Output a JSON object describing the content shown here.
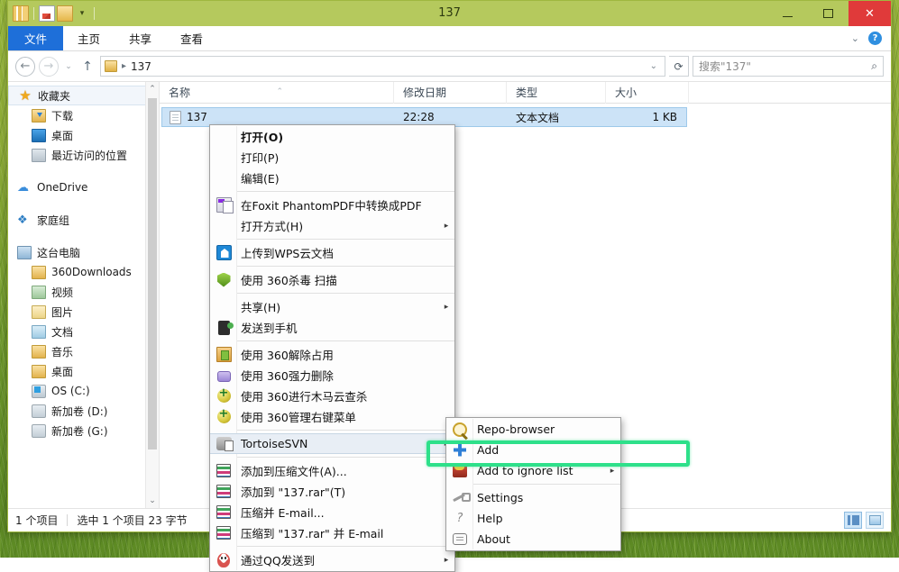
{
  "window": {
    "title": "137",
    "quick_access": [
      "folder-stripes-icon",
      "document-icon",
      "folder-icon",
      "dropdown-caret-icon"
    ],
    "controls": {
      "minimize": "—",
      "maximize": "□",
      "close": "✕"
    }
  },
  "ribbon": {
    "tabs": [
      {
        "id": "file",
        "label": "文件"
      },
      {
        "id": "home",
        "label": "主页"
      },
      {
        "id": "share",
        "label": "共享"
      },
      {
        "id": "view",
        "label": "查看"
      }
    ],
    "collapse_caret": "⌄",
    "help_label": "?"
  },
  "address_bar": {
    "back": "←",
    "forward": "→",
    "history_caret": "⌄",
    "up": "↑",
    "crumb_separator": "▸",
    "path": "137",
    "dropdown_caret": "⌄",
    "refresh": "⟳",
    "search_placeholder": "搜索\"137\"",
    "search_value": "",
    "search_icon": "⌕"
  },
  "nav_pane": {
    "items": [
      {
        "label": "收藏夹",
        "icon": "star-icon",
        "level": 1,
        "selected": true
      },
      {
        "label": "下载",
        "icon": "download-folder-icon",
        "level": 2
      },
      {
        "label": "桌面",
        "icon": "desktop-icon",
        "level": 2
      },
      {
        "label": "最近访问的位置",
        "icon": "recent-places-icon",
        "level": 2
      },
      {
        "label": "OneDrive",
        "icon": "onedrive-icon",
        "level": 1,
        "gap_before": true
      },
      {
        "label": "家庭组",
        "icon": "homegroup-icon",
        "level": 1,
        "gap_before": true
      },
      {
        "label": "这台电脑",
        "icon": "this-pc-icon",
        "level": 1,
        "gap_before": true
      },
      {
        "label": "360Downloads",
        "icon": "folder-icon",
        "level": 2
      },
      {
        "label": "视频",
        "icon": "videos-icon",
        "level": 2
      },
      {
        "label": "图片",
        "icon": "pictures-icon",
        "level": 2
      },
      {
        "label": "文档",
        "icon": "documents-icon",
        "level": 2
      },
      {
        "label": "音乐",
        "icon": "music-icon",
        "level": 2
      },
      {
        "label": "桌面",
        "icon": "desktop-folder-icon",
        "level": 2
      },
      {
        "label": "OS (C:)",
        "icon": "os-drive-icon",
        "level": 2
      },
      {
        "label": "新加卷 (D:)",
        "icon": "drive-icon",
        "level": 2
      },
      {
        "label": "新加卷 (G:)",
        "icon": "drive-icon",
        "level": 2
      }
    ],
    "scroll_up": "⌃",
    "scroll_down": "⌄"
  },
  "file_list": {
    "columns": [
      {
        "key": "name",
        "label": "名称",
        "sorted": true
      },
      {
        "key": "date",
        "label": "修改日期"
      },
      {
        "key": "type",
        "label": "类型"
      },
      {
        "key": "size",
        "label": "大小"
      }
    ],
    "sort_mark": "⌃",
    "rows": [
      {
        "name": "137",
        "icon": "text-file-icon",
        "date": "22:28",
        "type": "文本文档",
        "size": "1 KB",
        "selected": true
      }
    ]
  },
  "status_bar": {
    "item_count": "1 个项目",
    "selection": "选中 1 个项目 23 字节",
    "views": [
      {
        "name": "details-view",
        "active": true
      },
      {
        "name": "thumbnail-view",
        "active": false
      }
    ]
  },
  "context_menu": {
    "items": [
      {
        "label": "打开(O)",
        "bold": true,
        "icon": null
      },
      {
        "label": "打印(P)",
        "icon": null
      },
      {
        "label": "编辑(E)",
        "icon": null
      },
      {
        "separator": true
      },
      {
        "label": "在Foxit PhantomPDF中转换成PDF",
        "icon": "foxit-icon"
      },
      {
        "label": "打开方式(H)",
        "icon": null,
        "submenu": true
      },
      {
        "separator": true
      },
      {
        "label": "上传到WPS云文档",
        "icon": "wps-icon"
      },
      {
        "separator": true
      },
      {
        "label": "使用 360杀毒 扫描",
        "icon": "shield-360-icon"
      },
      {
        "separator": true
      },
      {
        "label": "共享(H)",
        "icon": null,
        "submenu": true
      },
      {
        "label": "发送到手机",
        "icon": "send-to-phone-icon"
      },
      {
        "separator": true
      },
      {
        "label": "使用 360解除占用",
        "icon": "360-unlock-icon"
      },
      {
        "label": "使用 360强力删除",
        "icon": "360-delete-icon"
      },
      {
        "label": "使用 360进行木马云查杀",
        "icon": "360-scan-icon"
      },
      {
        "label": "使用 360管理右键菜单",
        "icon": "360-manage-icon"
      },
      {
        "separator": true
      },
      {
        "label": "TortoiseSVN",
        "icon": "tortoisesvn-icon",
        "submenu": true,
        "hovered": true
      },
      {
        "separator": true
      },
      {
        "label": "添加到压缩文件(A)...",
        "icon": "winrar-icon"
      },
      {
        "label": "添加到 \"137.rar\"(T)",
        "icon": "winrar-icon"
      },
      {
        "label": "压缩并 E-mail...",
        "icon": "winrar-icon"
      },
      {
        "label": "压缩到 \"137.rar\" 并 E-mail",
        "icon": "winrar-icon"
      },
      {
        "separator": true
      },
      {
        "label": "通过QQ发送到",
        "icon": "qq-icon",
        "submenu": true
      }
    ],
    "submenu_arrow": "▸"
  },
  "tortoisesvn_submenu": {
    "items": [
      {
        "label": "Repo-browser",
        "icon": "repo-browser-icon"
      },
      {
        "label": "Add",
        "icon": "add-icon",
        "highlighted": true
      },
      {
        "label": "Add to ignore list",
        "icon": "ignore-list-icon",
        "submenu": true
      },
      {
        "separator": true
      },
      {
        "label": "Settings",
        "icon": "settings-icon"
      },
      {
        "label": "Help",
        "icon": "help-icon"
      },
      {
        "label": "About",
        "icon": "about-icon"
      }
    ],
    "submenu_arrow": "▸"
  },
  "annotation": {
    "highlight_color": "#2ee08a",
    "target": "Add"
  }
}
